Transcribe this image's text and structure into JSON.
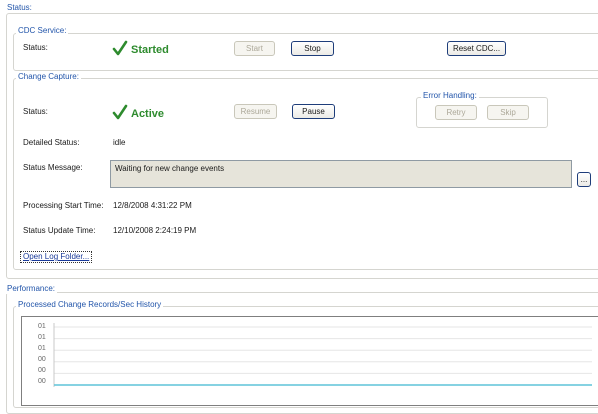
{
  "status_group": {
    "title": "Status:"
  },
  "cdc_service": {
    "title": "CDC Service:",
    "status_label": "Status:",
    "status_value": "Started",
    "start_label": "Start",
    "stop_label": "Stop",
    "reset_label": "Reset CDC..."
  },
  "change_capture": {
    "title": "Change Capture:",
    "status_label": "Status:",
    "status_value": "Active",
    "resume_label": "Resume",
    "pause_label": "Pause",
    "error_handling": {
      "title": "Error Handling:",
      "retry_label": "Retry",
      "skip_label": "Skip"
    },
    "detailed_status_label": "Detailed Status:",
    "detailed_status_value": "idle",
    "status_message_label": "Status Message:",
    "status_message_value": "Waiting for new change events",
    "ellipsis_label": "...",
    "processing_start_label": "Processing Start Time:",
    "processing_start_value": "12/8/2008 4:31:22 PM",
    "status_update_label": "Status Update Time:",
    "status_update_value": "12/10/2008 2:24:19 PM",
    "open_log_label": "Open Log Folder..."
  },
  "performance": {
    "title": "Performance:"
  },
  "chart_data": {
    "type": "line",
    "title": "Processed Change Records/Sec History",
    "y_tick_labels": [
      "01",
      "01",
      "01",
      "00",
      "00",
      "00"
    ],
    "series": [
      {
        "values": [
          0,
          0,
          0,
          0,
          0,
          0,
          0,
          0,
          0,
          0,
          0,
          0
        ],
        "color": "#5fc4d8"
      }
    ],
    "ylim": [
      0,
      1
    ],
    "grid": true
  }
}
